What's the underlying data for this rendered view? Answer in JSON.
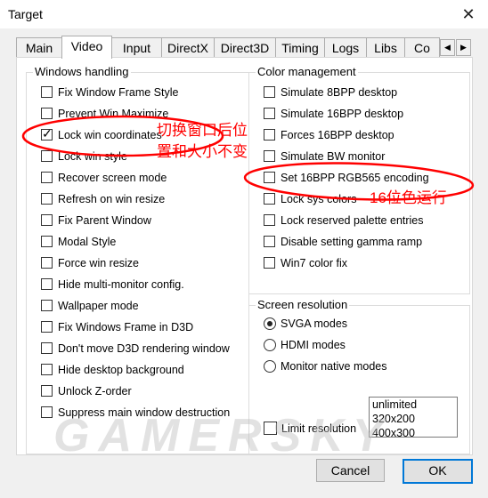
{
  "window": {
    "title": "Target",
    "close_glyph": "✕"
  },
  "tabs": [
    "Main",
    "Video",
    "Input",
    "DirectX",
    "Direct3D",
    "Timing",
    "Logs",
    "Libs",
    "Co"
  ],
  "tab_scroll": {
    "left": "◀",
    "right": "▶"
  },
  "windows_handling": {
    "title": "Windows handling",
    "items": [
      {
        "label": "Fix Window Frame Style",
        "checked": false
      },
      {
        "label": "Prevent Win Maximize",
        "checked": false
      },
      {
        "label": "Lock win coordinates",
        "checked": true
      },
      {
        "label": "Lock win style",
        "checked": false
      },
      {
        "label": "Recover screen mode",
        "checked": false
      },
      {
        "label": "Refresh on win resize",
        "checked": false
      },
      {
        "label": "Fix Parent Window",
        "checked": false
      },
      {
        "label": "Modal Style",
        "checked": false
      },
      {
        "label": "Force win resize",
        "checked": false
      },
      {
        "label": "Hide multi-monitor config.",
        "checked": false
      },
      {
        "label": "Wallpaper mode",
        "checked": false
      },
      {
        "label": "Fix Windows Frame in D3D",
        "checked": false
      },
      {
        "label": "Don't move D3D rendering window",
        "checked": false
      },
      {
        "label": "Hide desktop background",
        "checked": false
      },
      {
        "label": "Unlock Z-order",
        "checked": false
      },
      {
        "label": "Suppress main window destruction",
        "checked": false
      }
    ]
  },
  "color_management": {
    "title": "Color management",
    "items": [
      {
        "label": "Simulate 8BPP desktop",
        "checked": false
      },
      {
        "label": "Simulate 16BPP desktop",
        "checked": false
      },
      {
        "label": "Forces 16BPP desktop",
        "checked": false
      },
      {
        "label": "Simulate BW monitor",
        "checked": false
      },
      {
        "label": "Set 16BPP RGB565 encoding",
        "checked": false
      },
      {
        "label": "Lock sys colors",
        "checked": false
      },
      {
        "label": "Lock reserved palette entries",
        "checked": false
      },
      {
        "label": "Disable setting gamma ramp",
        "checked": false
      },
      {
        "label": "Win7 color fix",
        "checked": false
      }
    ]
  },
  "screen_resolution": {
    "title": "Screen resolution",
    "options": [
      {
        "label": "SVGA modes",
        "selected": true
      },
      {
        "label": "HDMI modes",
        "selected": false
      },
      {
        "label": "Monitor native modes",
        "selected": false
      }
    ],
    "limit_label": "Limit  resolution",
    "limit_checked": false,
    "list_items": [
      "unlimited",
      "320x200",
      "400x300"
    ]
  },
  "buttons": {
    "cancel": "Cancel",
    "ok": "OK"
  },
  "annotations": {
    "lock_note_line1": "切换窗口后位",
    "lock_note_line2": "置和大小不变",
    "color_note": "16位色运行",
    "color": "#ff0000"
  },
  "watermark": "GAMERSKY",
  "colors": {
    "accent": "#0078d7",
    "dialog_bg": "#f0f0f0",
    "annotation": "#ff0000"
  }
}
